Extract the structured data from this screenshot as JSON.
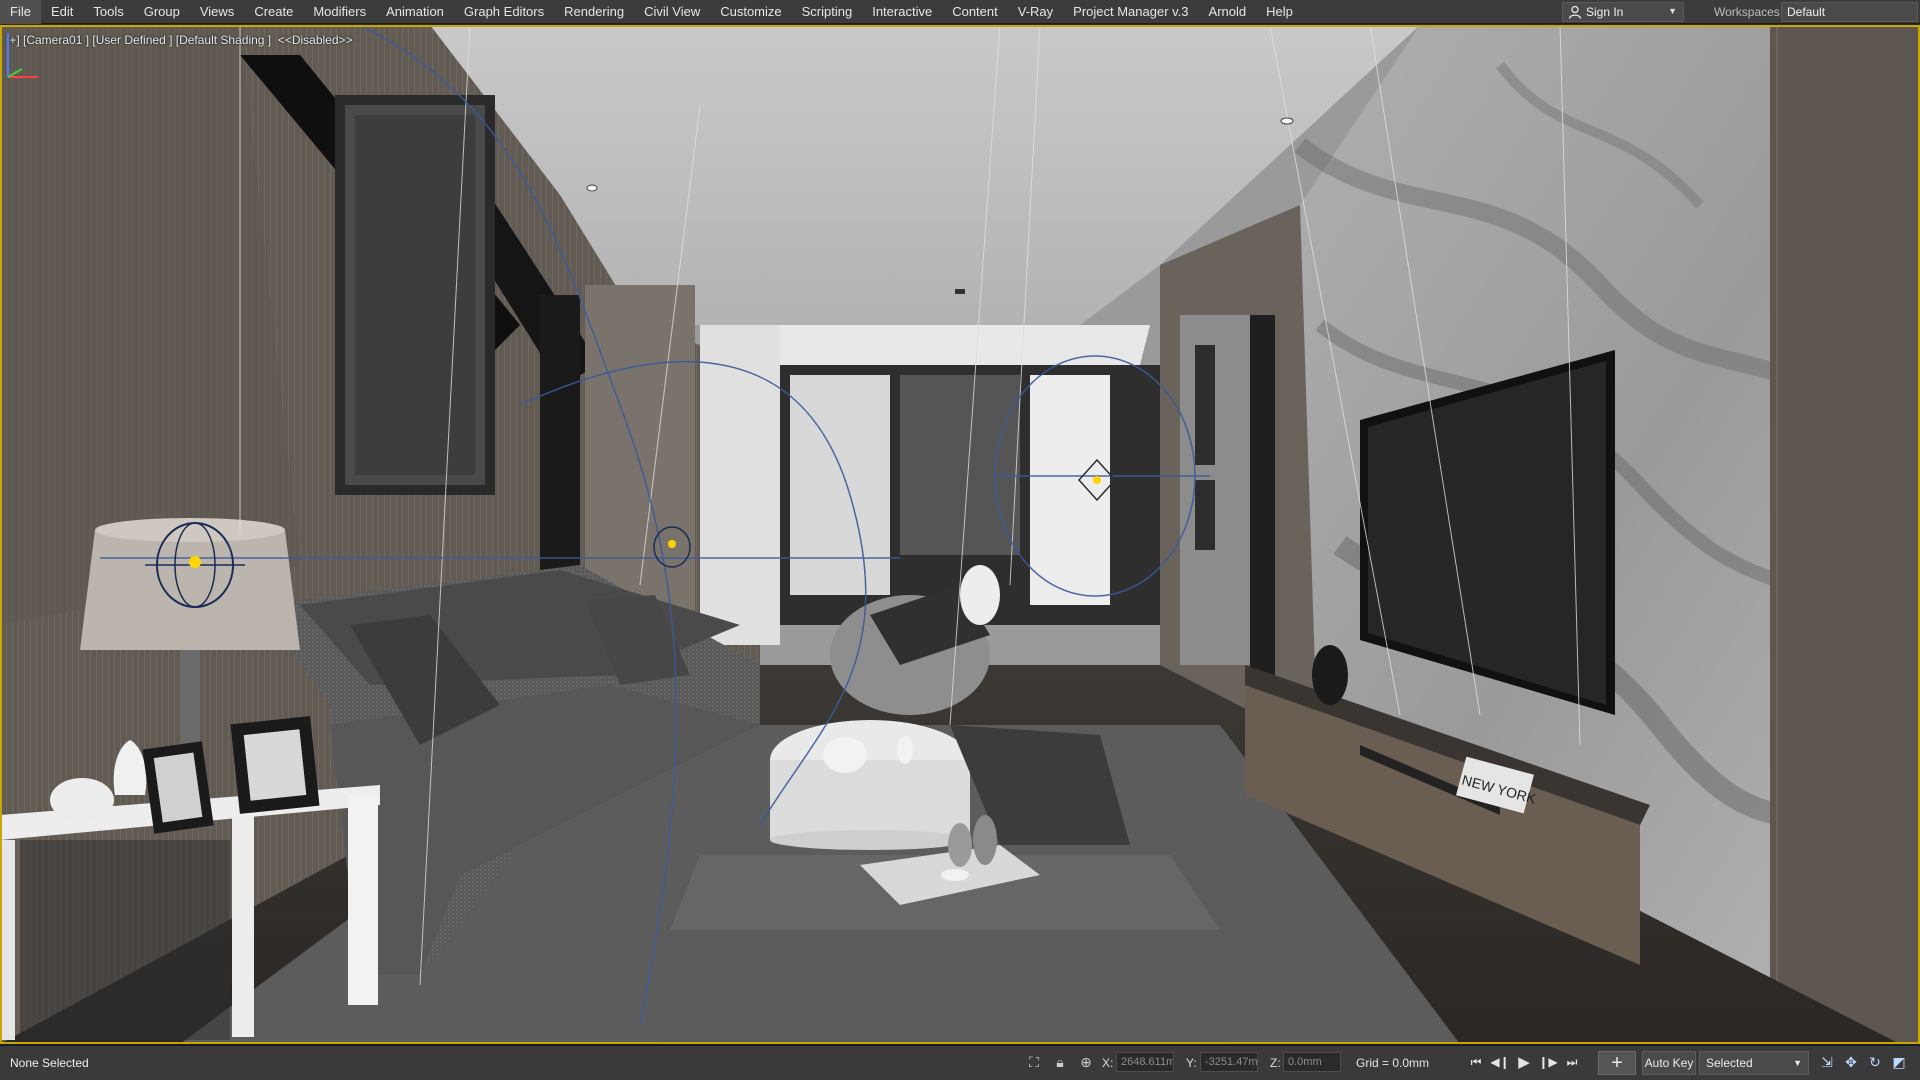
{
  "menu": {
    "items": [
      "File",
      "Edit",
      "Tools",
      "Group",
      "Views",
      "Create",
      "Modifiers",
      "Animation",
      "Graph Editors",
      "Rendering",
      "Civil View",
      "Customize",
      "Scripting",
      "Interactive",
      "Content",
      "V-Ray",
      "Project Manager v.3",
      "Arnold",
      "Help"
    ],
    "sign_in": "Sign In",
    "workspaces_label": "Workspaces:",
    "workspace_value": "Default"
  },
  "viewport": {
    "label": "[+] [Camera01 ] [User Defined ] [Default Shading ]  <<Disabled>>",
    "tv_box_text": "NEW YORK"
  },
  "status": {
    "selection": "None Selected",
    "x_label": "X:",
    "x_value": "2648.611m",
    "y_label": "Y:",
    "y_value": "-3251.47m",
    "z_label": "Z:",
    "z_value": "0.0mm",
    "grid": "Grid = 0.0mm",
    "auto_key": "Auto Key",
    "selected": "Selected"
  },
  "colors": {
    "menubar": "#3c3c3c",
    "viewport_border": "#c8a800",
    "light_gizmo": "#ffd400",
    "helper_lines": "#3a5a9a"
  }
}
